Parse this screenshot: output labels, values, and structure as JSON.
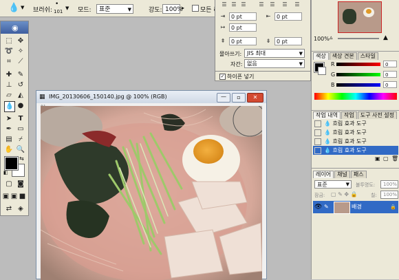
{
  "options_bar": {
    "brush_label": "브러쉬:",
    "brush_size": "101",
    "mode_label": "모드:",
    "mode_value": "표준",
    "strength_label": "강도:",
    "strength_value": "100%",
    "all_layers_label": "모든 레"
  },
  "paragraph_panel": {
    "indent_left": "0 pt",
    "indent_right": "0 pt",
    "indent_first": "0 pt",
    "space_before": "0 pt",
    "space_after": "0 pt",
    "mojikumi_label": "몰아쓰기:",
    "mojikumi_value": "JIS 최대",
    "kinsoku_label": "자간:",
    "kinsoku_value": "없음",
    "hyphenate_label": "하이픈 넣기"
  },
  "image_window": {
    "title": "IMG_20130606_150140.jpg @ 100% (RGB)"
  },
  "navigator": {
    "zoom": "100%"
  },
  "color_panel": {
    "tabs": [
      "색상",
      "색상 견본",
      "스타일"
    ],
    "r_label": "R",
    "g_label": "G",
    "b_label": "B",
    "r_value": "0",
    "g_value": "0",
    "b_value": "0"
  },
  "history_panel": {
    "tabs": [
      "작업 내역",
      "작업",
      "도구 사전 설정"
    ],
    "items": [
      "흐림 효과 도구",
      "흐림 효과 도구",
      "흐림 효과 도구",
      "흐림 효과 도구"
    ]
  },
  "layers_panel": {
    "tabs": [
      "레이어",
      "채널",
      "패스"
    ],
    "blend_mode": "표준",
    "opacity_label": "불투명도:",
    "opacity_value": "100%",
    "lock_label": "잠금:",
    "fill_label": "칠:",
    "fill_value": "100%",
    "layer_name": "배경"
  },
  "colors": {
    "selection": "#316ac5",
    "panel_bg": "#ece9d8"
  }
}
